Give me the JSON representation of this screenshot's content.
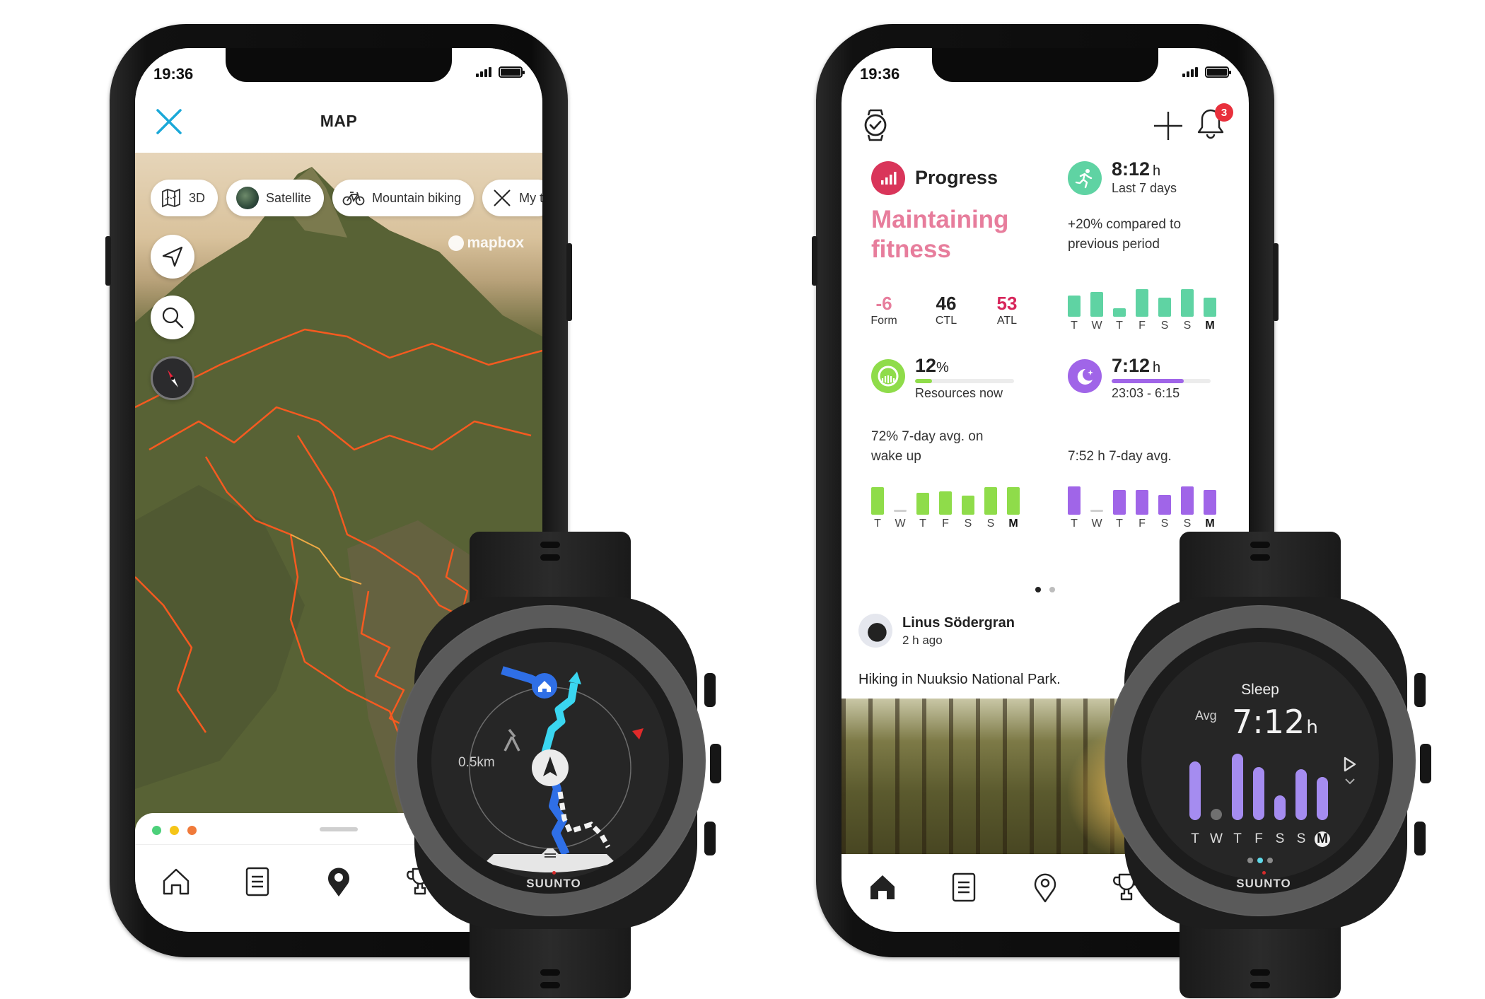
{
  "left_phone": {
    "status_bar": {
      "time": "19:36"
    },
    "header": {
      "title": "MAP",
      "close_icon": "close-x-icon"
    },
    "map": {
      "chips": [
        {
          "icon": "map-3d-icon",
          "label": "3D"
        },
        {
          "icon": "satellite-globe-icon",
          "label": "Satellite"
        },
        {
          "icon": "bicycle-icon",
          "label": "Mountain biking"
        },
        {
          "icon": "close-x-icon",
          "label": "My t"
        }
      ],
      "controls": [
        "locate-arrow-icon",
        "search-icon",
        "compass-icon"
      ],
      "attribution": "mapbox"
    },
    "bottom_sheet": {
      "dots": [
        "#4cd07a",
        "#f5c518",
        "#f07a3a"
      ]
    },
    "tabbar": [
      {
        "icon": "home-outline-icon",
        "active": false
      },
      {
        "icon": "document-list-icon",
        "active": false
      },
      {
        "icon": "map-pin-filled-icon",
        "active": true
      },
      {
        "icon": "trophy-icon",
        "active": false
      }
    ]
  },
  "right_phone": {
    "status_bar": {
      "time": "19:36"
    },
    "header": {
      "watch_icon": "watch-check-icon",
      "add_icon": "plus-icon",
      "notifications_count": "3"
    },
    "progress": {
      "title": "Progress",
      "status": "Maintaining fitness",
      "metrics": [
        {
          "value": "-6",
          "label": "Form",
          "color": "#e77d9c"
        },
        {
          "value": "46",
          "label": "CTL",
          "color": "#222222"
        },
        {
          "value": "53",
          "label": "ATL",
          "color": "#d7265b"
        }
      ],
      "accent": "#d9355a"
    },
    "activity": {
      "value": "8:12",
      "unit": "h",
      "sub": "Last 7 days",
      "desc": "+20% compared to previous period",
      "accent": "#5fd3a3",
      "days": [
        "T",
        "W",
        "T",
        "F",
        "S",
        "S",
        "M"
      ],
      "values": [
        0.65,
        0.75,
        0.25,
        0.85,
        0.58,
        0.85,
        0.58
      ]
    },
    "resources": {
      "value": "12",
      "unit": "%",
      "sub": "Resources now",
      "fill": 0.17,
      "desc": "72% 7-day avg. on wake up",
      "accent": "#8fdc4a",
      "days": [
        "T",
        "W",
        "T",
        "F",
        "S",
        "S",
        "M"
      ],
      "values": [
        0.85,
        null,
        0.68,
        0.72,
        0.58,
        0.85,
        0.85
      ]
    },
    "sleep": {
      "value": "7:12",
      "unit": "h",
      "sub": "23:03 - 6:15",
      "fill": 0.73,
      "desc": "7:52 h 7-day avg.",
      "accent": "#a065e8",
      "days": [
        "T",
        "W",
        "T",
        "F",
        "S",
        "S",
        "M"
      ],
      "values": [
        0.88,
        null,
        0.75,
        0.75,
        0.6,
        0.88,
        0.75
      ]
    },
    "pager": {
      "count": 2,
      "active": 0
    },
    "feed": {
      "author": "Linus Södergran",
      "time": "2 h ago",
      "text": "Hiking in Nuuksio National Park."
    },
    "tabbar": [
      {
        "icon": "home-filled-icon",
        "active": true
      },
      {
        "icon": "document-list-icon",
        "active": false
      },
      {
        "icon": "map-pin-outline-icon",
        "active": false
      },
      {
        "icon": "trophy-icon",
        "active": false
      }
    ]
  },
  "watch_nav": {
    "distance_label": "0.5km",
    "brand": "SUUNTO"
  },
  "watch_sleep": {
    "title": "Sleep",
    "avg_label": "Avg",
    "value": "7:12",
    "unit": "h",
    "days": [
      "T",
      "W",
      "T",
      "F",
      "S",
      "S",
      "M"
    ],
    "values": [
      0.75,
      null,
      0.85,
      0.68,
      0.32,
      0.65,
      0.55
    ],
    "pager": {
      "count": 3,
      "active": 1
    },
    "brand": "SUUNTO"
  }
}
